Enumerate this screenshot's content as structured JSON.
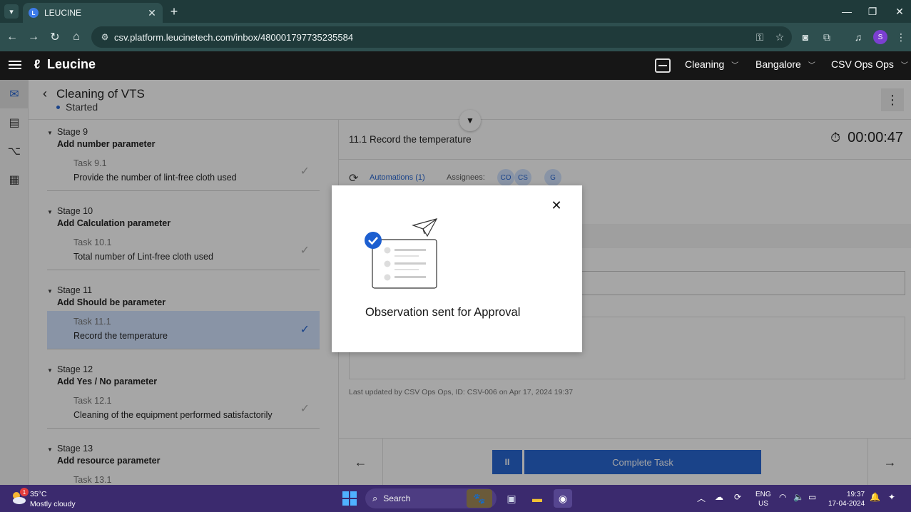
{
  "browser": {
    "tab_title": "LEUCINE",
    "url": "csv.platform.leucinetech.com/inbox/480001797735235584",
    "profile_initial": "S"
  },
  "app": {
    "brand": "Leucine",
    "header": {
      "dropdowns": [
        "Cleaning",
        "Bangalore",
        "CSV Ops Ops"
      ]
    }
  },
  "job": {
    "title": "Cleaning of VTS",
    "status": "Started"
  },
  "stages": [
    {
      "stage_no": "Stage 9",
      "name": "Add number parameter",
      "task_no": "Task 9.1",
      "task_name": "Provide the number of lint-free cloth used",
      "active": false
    },
    {
      "stage_no": "Stage 10",
      "name": "Add Calculation parameter",
      "task_no": "Task 10.1",
      "task_name": "Total number of Lint-free cloth used",
      "active": false
    },
    {
      "stage_no": "Stage 11",
      "name": "Add Should be parameter",
      "task_no": "Task 11.1",
      "task_name": "Record the temperature",
      "active": true
    },
    {
      "stage_no": "Stage 12",
      "name": "Add Yes / No parameter",
      "task_no": "Task 12.1",
      "task_name": "Cleaning of the equipment performed satisfactorily",
      "active": false
    },
    {
      "stage_no": "Stage 13",
      "name": "Add resource parameter",
      "task_no": "Task 13.1",
      "task_name": "",
      "active": false
    }
  ],
  "task_panel": {
    "title": "11.1 Record the temperature",
    "timer": "00:00:47",
    "automations_label": "Automations (1)",
    "assignees_label": "Assignees:",
    "assignees": [
      "CO",
      "CS",
      "G"
    ],
    "last_updated": "Last updated by CSV Ops Ops, ID: CSV-006 on Apr 17, 2024 19:37",
    "complete_label": "Complete Task",
    "pause_label": "II"
  },
  "modal": {
    "message": "Observation sent for Approval"
  },
  "taskbar": {
    "weather_temp": "35°C",
    "weather_desc": "Mostly cloudy",
    "weather_badge": "1",
    "search_label": "Search",
    "lang_1": "ENG",
    "lang_2": "US",
    "time": "19:37",
    "date": "17-04-2024"
  },
  "colors": {
    "primary": "#1d5fd0",
    "active_task_bg": "#d0e2ff",
    "header_bg": "#161616",
    "taskbar_bg": "#3b2a6e"
  }
}
